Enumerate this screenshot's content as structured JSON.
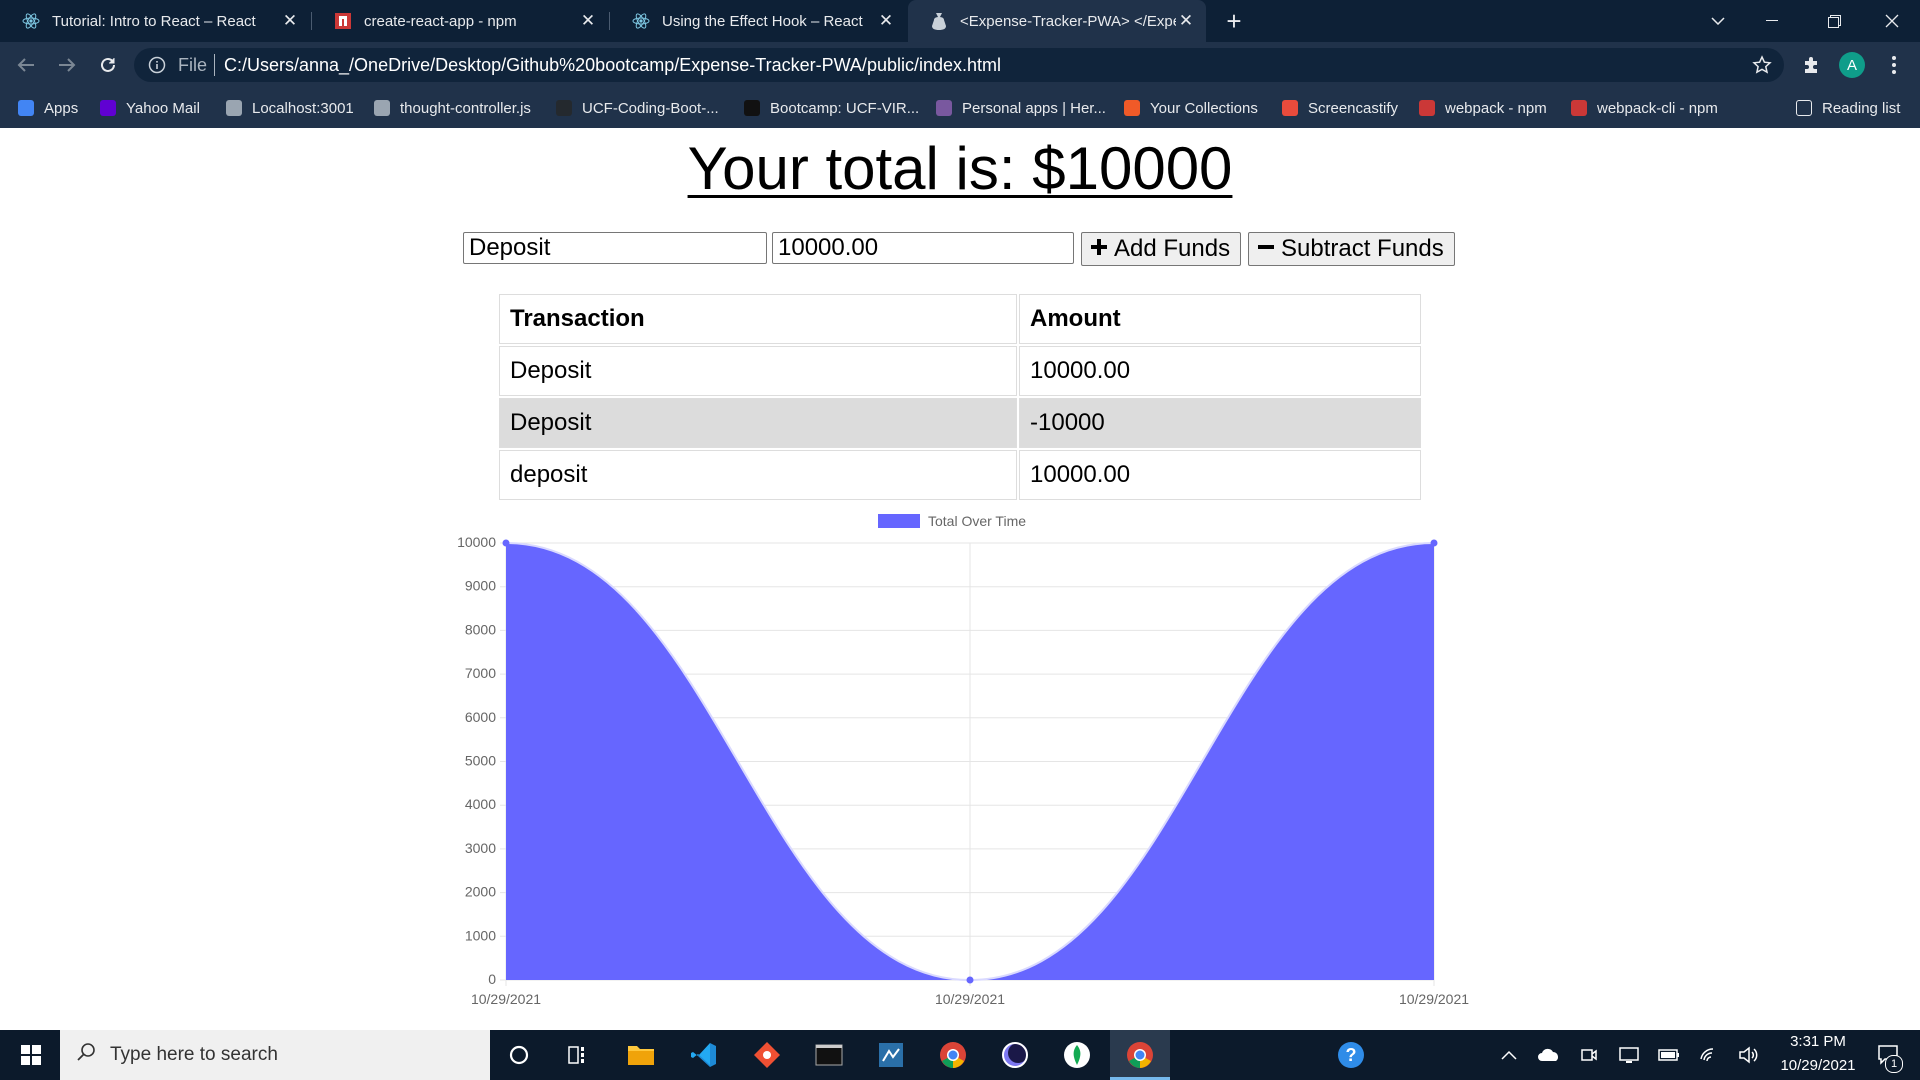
{
  "browser": {
    "tabs": [
      {
        "label": "Tutorial: Intro to React – React",
        "icon": "react-icon"
      },
      {
        "label": "create-react-app - npm",
        "icon": "npm-icon"
      },
      {
        "label": "Using the Effect Hook – React",
        "icon": "react-icon"
      },
      {
        "label": "<Expense-Tracker-PWA> </Expen",
        "icon": "moneybag-icon"
      }
    ],
    "address_prefix": "File",
    "url": "C:/Users/anna_/OneDrive/Desktop/Github%20bootcamp/Expense-Tracker-PWA/public/index.html",
    "profile_initial": "A",
    "bookmarks": [
      {
        "label": "Apps",
        "color": "#4285f4"
      },
      {
        "label": "Yahoo Mail",
        "color": "#6001d2"
      },
      {
        "label": "Localhost:3001",
        "color": "#9aa5b1"
      },
      {
        "label": "thought-controller.js",
        "color": "#9aa5b1"
      },
      {
        "label": "UCF-Coding-Boot-...",
        "color": "#24292e"
      },
      {
        "label": "Bootcamp: UCF-VIR...",
        "color": "#111111"
      },
      {
        "label": "Personal apps | Her...",
        "color": "#79589f"
      },
      {
        "label": "Your Collections",
        "color": "#f05a28"
      },
      {
        "label": "Screencastify",
        "color": "#e94b3c"
      },
      {
        "label": "webpack - npm",
        "color": "#cb3837"
      },
      {
        "label": "webpack-cli - npm",
        "color": "#cb3837"
      }
    ],
    "reading_list": "Reading list"
  },
  "app": {
    "total_text": "Your total is: $10000",
    "name_value": "Deposit",
    "amount_value": "10000.00",
    "add_label": "Add Funds",
    "subtract_label": "Subtract Funds",
    "table": {
      "headers": [
        "Transaction",
        "Amount"
      ],
      "rows": [
        [
          "Deposit",
          "10000.00"
        ],
        [
          "Deposit",
          "-10000"
        ],
        [
          "deposit",
          "10000.00"
        ]
      ]
    }
  },
  "chart_data": {
    "type": "area",
    "x": [
      "10/29/2021",
      "10/29/2021",
      "10/29/2021"
    ],
    "series": [
      {
        "name": "Total Over Time",
        "values": [
          10000,
          0,
          10000
        ],
        "color": "#6666ff"
      }
    ],
    "ylim": [
      0,
      10000
    ],
    "yticks": [
      0,
      1000,
      2000,
      3000,
      4000,
      5000,
      6000,
      7000,
      8000,
      9000,
      10000
    ],
    "legend": "top",
    "grid": true
  },
  "taskbar": {
    "search_placeholder": "Type here to search",
    "time": "3:31 PM",
    "date": "10/29/2021",
    "notification_count": "1"
  }
}
